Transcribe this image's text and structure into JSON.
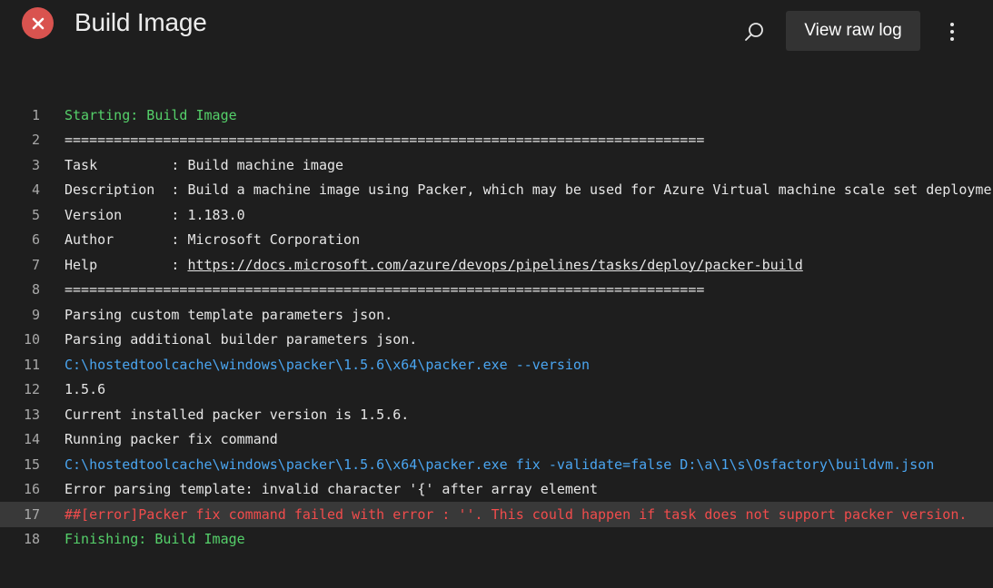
{
  "header": {
    "title": "Build Image",
    "status": "failed",
    "status_icon": "error-x-icon",
    "status_color": "#d9534f",
    "search_icon": "search-icon",
    "raw_log_label": "View raw log",
    "more_icon": "more-vertical-icon"
  },
  "log": {
    "lines": [
      {
        "n": "1",
        "text": "Starting: Build Image",
        "color": "green"
      },
      {
        "n": "2",
        "text": "==============================================================================",
        "color": "text"
      },
      {
        "n": "3",
        "text": "Task         : Build machine image",
        "color": "text"
      },
      {
        "n": "4",
        "text": "Description  : Build a machine image using Packer, which may be used for Azure Virtual machine scale set deployme",
        "color": "text"
      },
      {
        "n": "5",
        "text": "Version      : 1.183.0",
        "color": "text"
      },
      {
        "n": "6",
        "text": "Author       : Microsoft Corporation",
        "color": "text"
      },
      {
        "n": "7",
        "prefix": "Help         : ",
        "link": "https://docs.microsoft.com/azure/devops/pipelines/tasks/deploy/packer-build",
        "color": "text"
      },
      {
        "n": "8",
        "text": "==============================================================================",
        "color": "text"
      },
      {
        "n": "9",
        "text": "Parsing custom template parameters json.",
        "color": "text"
      },
      {
        "n": "10",
        "text": "Parsing additional builder parameters json.",
        "color": "text"
      },
      {
        "n": "11",
        "text": "C:\\hostedtoolcache\\windows\\packer\\1.5.6\\x64\\packer.exe --version",
        "color": "blue"
      },
      {
        "n": "12",
        "text": "1.5.6",
        "color": "text"
      },
      {
        "n": "13",
        "text": "Current installed packer version is 1.5.6.",
        "color": "text"
      },
      {
        "n": "14",
        "text": "Running packer fix command",
        "color": "text"
      },
      {
        "n": "15",
        "text": "C:\\hostedtoolcache\\windows\\packer\\1.5.6\\x64\\packer.exe fix -validate=false D:\\a\\1\\s\\Osfactory\\buildvm.json",
        "color": "blue"
      },
      {
        "n": "16",
        "text": "Error parsing template: invalid character '{' after array element",
        "color": "text"
      },
      {
        "n": "17",
        "text": "##[error]Packer fix command failed with error : ''. This could happen if task does not support packer version.",
        "color": "red",
        "highlight": true
      },
      {
        "n": "18",
        "text": "Finishing: Build Image",
        "color": "green"
      }
    ]
  },
  "colors": {
    "background": "#1e1e1e",
    "green": "#55d06a",
    "blue": "#4aa5f0",
    "red": "#f14c4c",
    "highlight": "#393939"
  }
}
